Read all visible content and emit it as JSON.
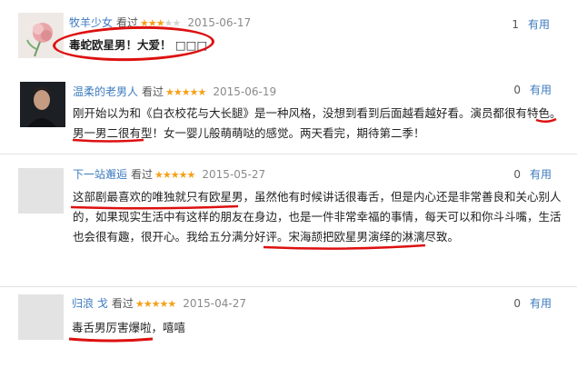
{
  "reviews": [
    {
      "username": "牧羊少女",
      "action": "看过",
      "rating": 3,
      "date": "2015-06-17",
      "helpful_count": "1",
      "helpful_label": "有用",
      "content": "毒蛇欧星男！大爱！ □□□"
    },
    {
      "username": "温柔的老男人",
      "action": "看过",
      "rating": 5,
      "date": "2015-06-19",
      "helpful_count": "0",
      "helpful_label": "有用",
      "content": "刚开始以为和《白衣校花与大长腿》是一种风格，没想到看到后面越看越好看。演员都很有特色。男一男二很有型！女一婴儿般萌萌哒的感觉。两天看完，期待第二季！"
    },
    {
      "username": "下一站邂逅",
      "action": "看过",
      "rating": 5,
      "date": "2015-05-27",
      "helpful_count": "0",
      "helpful_label": "有用",
      "content": "这部剧最喜欢的唯独就只有欧星男，虽然他有时候讲话很毒舌，但是内心还是非常善良和关心别人的，如果现实生活中有这样的朋友在身边，也是一件非常幸福的事情，每天可以和你斗斗嘴，生活也会很有趣，很开心。我给五分满分好评。宋海颉把欧星男演绎的淋漓尽致。"
    },
    {
      "username": "归浪 戈",
      "action": "看过",
      "rating": 5,
      "date": "2015-04-27",
      "helpful_count": "0",
      "helpful_label": "有用",
      "content": "毒舌男厉害爆啦，嘻嘻"
    }
  ],
  "annotation_color": "#dd1010",
  "star_color": "#f6a018",
  "link_color": "#3c7abf"
}
